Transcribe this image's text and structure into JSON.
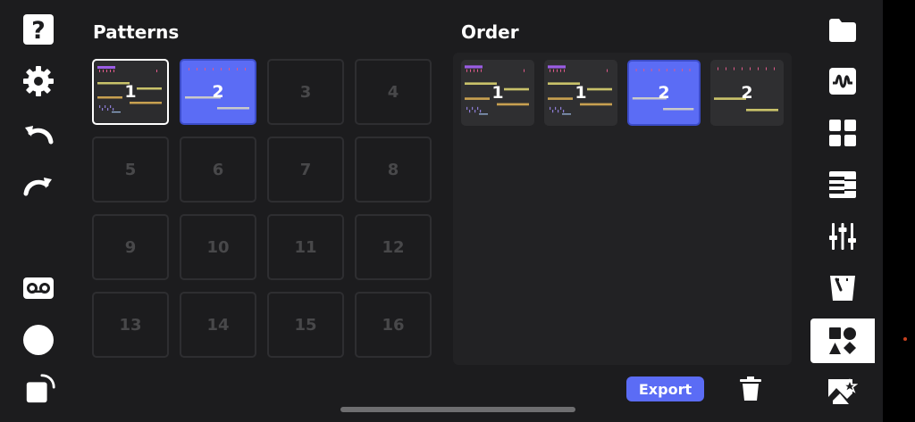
{
  "accent_color": "#5b6cf5",
  "patterns": {
    "title": "Patterns",
    "slots": [
      {
        "label": "1",
        "state": "selected"
      },
      {
        "label": "2",
        "state": "active"
      },
      {
        "label": "3",
        "state": "empty"
      },
      {
        "label": "4",
        "state": "empty"
      },
      {
        "label": "5",
        "state": "empty"
      },
      {
        "label": "6",
        "state": "empty"
      },
      {
        "label": "7",
        "state": "empty"
      },
      {
        "label": "8",
        "state": "empty"
      },
      {
        "label": "9",
        "state": "empty"
      },
      {
        "label": "10",
        "state": "empty"
      },
      {
        "label": "11",
        "state": "empty"
      },
      {
        "label": "12",
        "state": "empty"
      },
      {
        "label": "13",
        "state": "empty"
      },
      {
        "label": "14",
        "state": "empty"
      },
      {
        "label": "15",
        "state": "empty"
      },
      {
        "label": "16",
        "state": "empty"
      }
    ]
  },
  "order": {
    "title": "Order",
    "items": [
      {
        "label": "1",
        "pattern": "1"
      },
      {
        "label": "1",
        "pattern": "1"
      },
      {
        "label": "2",
        "pattern": "2"
      },
      {
        "label": "2",
        "pattern": "2"
      }
    ]
  },
  "actions": {
    "export_label": "Export"
  },
  "left_toolbar": [
    "help-icon",
    "settings-gear-icon",
    "undo-icon",
    "redo-icon",
    "cassette-tape-icon",
    "record-icon",
    "loop-square-icon"
  ],
  "right_toolbar": [
    "folder-icon",
    "waveform-icon",
    "grid-icon",
    "piano-keys-icon",
    "mixer-sliders-icon",
    "tempo-meter-icon",
    "shapes-icon",
    "image-star-icon"
  ],
  "right_toolbar_active": "shapes-icon"
}
